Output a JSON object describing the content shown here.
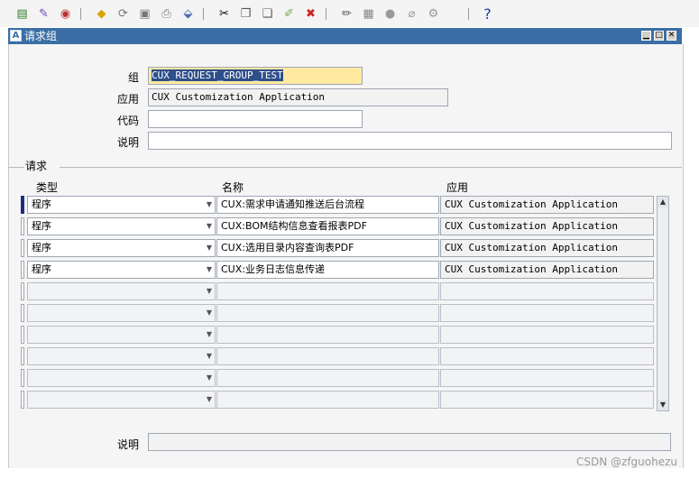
{
  "toolbar": {
    "icons": [
      "new-record",
      "find",
      "navigator",
      "save",
      "next-step",
      "switch-responsibility",
      "print",
      "close-form",
      "cut",
      "copy",
      "paste",
      "clear-record",
      "delete-record",
      "edit-field",
      "zoom",
      "translations",
      "attachments",
      "folder-tools",
      "help"
    ],
    "help_label": "?"
  },
  "window": {
    "title": "请求组",
    "controls": [
      "minimize",
      "maximize",
      "close"
    ]
  },
  "header": {
    "group_label": "组",
    "group_value": "CUX_REQUEST_GROUP_TEST",
    "application_label": "应用",
    "application_value": "CUX Customization Application",
    "code_label": "代码",
    "code_value": "",
    "description_label": "说明",
    "description_value": ""
  },
  "requests": {
    "section_label": "请求",
    "columns": {
      "type": "类型",
      "name": "名称",
      "application": "应用"
    },
    "rows": [
      {
        "type": "程序",
        "name": "CUX:需求申请通知推送后台流程",
        "application": "CUX Customization Application"
      },
      {
        "type": "程序",
        "name": "CUX:BOM结构信息查看报表PDF",
        "application": "CUX Customization Application"
      },
      {
        "type": "程序",
        "name": "CUX:选用目录内容查询表PDF",
        "application": "CUX Customization Application"
      },
      {
        "type": "程序",
        "name": "CUX:业务日志信息传递",
        "application": "CUX Customization Application"
      },
      {
        "type": "",
        "name": "",
        "application": ""
      },
      {
        "type": "",
        "name": "",
        "application": ""
      },
      {
        "type": "",
        "name": "",
        "application": ""
      },
      {
        "type": "",
        "name": "",
        "application": ""
      },
      {
        "type": "",
        "name": "",
        "application": ""
      },
      {
        "type": "",
        "name": "",
        "application": ""
      }
    ]
  },
  "footer": {
    "description_label": "说明",
    "description_value": ""
  },
  "watermark": "CSDN @zfguohezu",
  "colors": {
    "title_bar": "#3a6ea5",
    "selected_field": "#ffeaa0",
    "current_row_marker": "#1f2c86"
  }
}
